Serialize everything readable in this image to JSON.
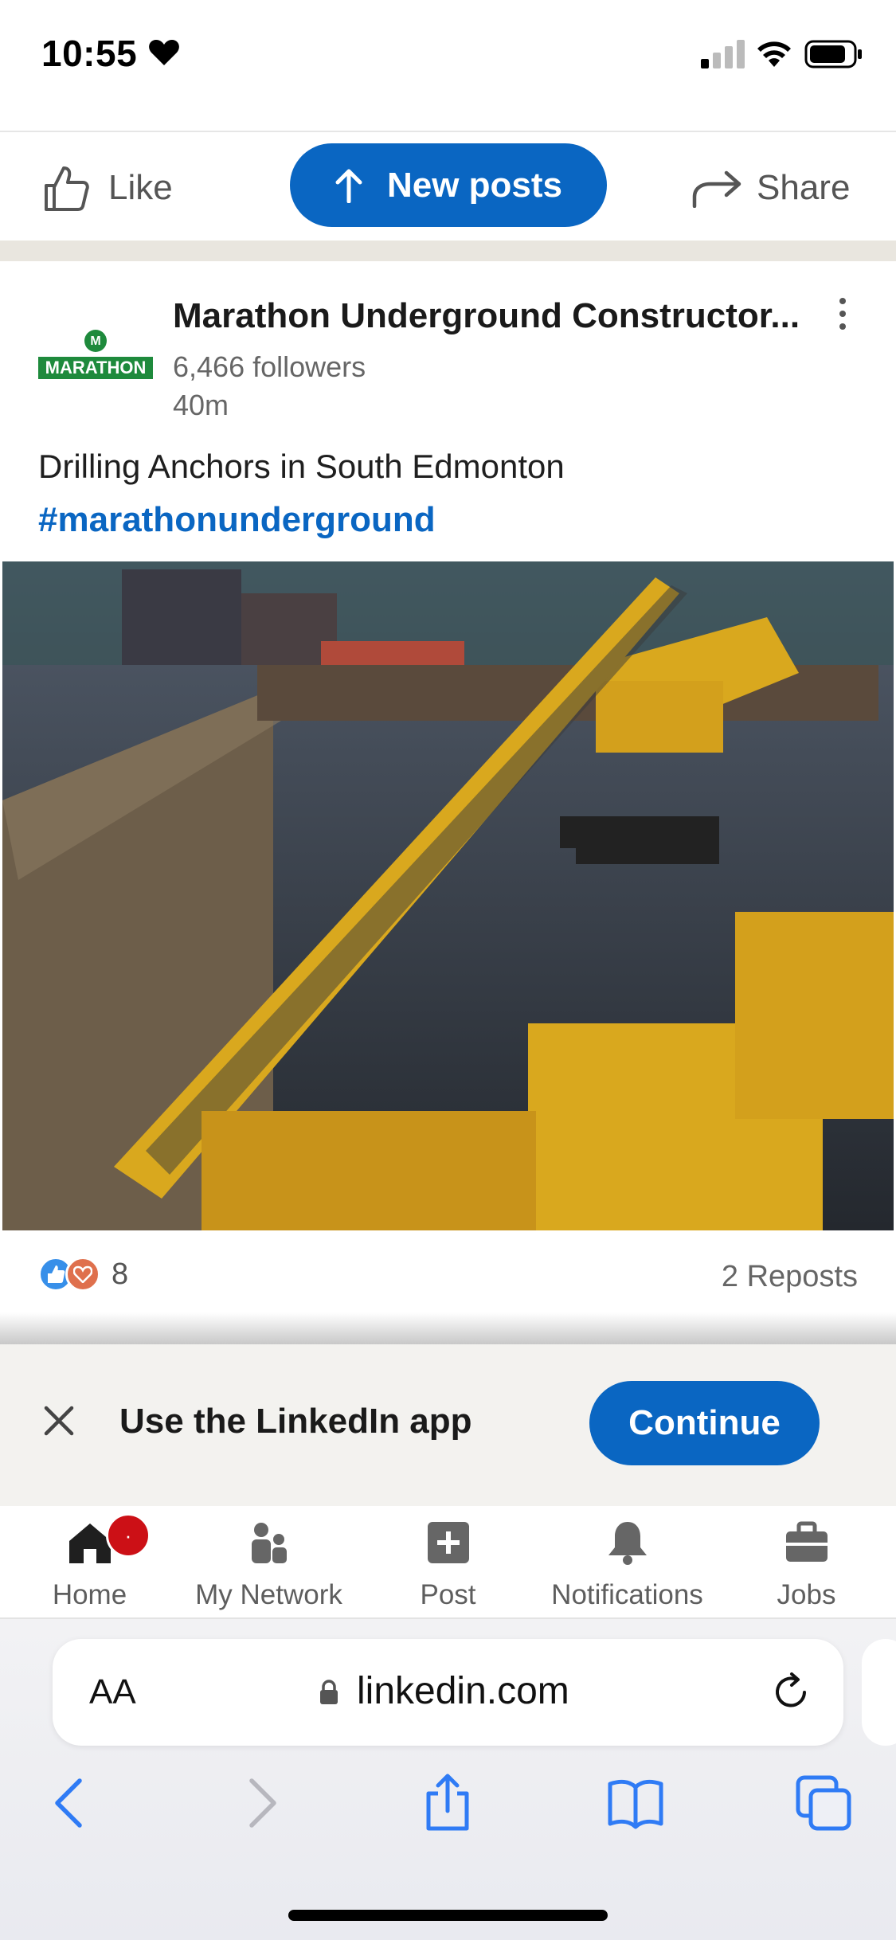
{
  "status_bar": {
    "time": "10:55"
  },
  "action_bar": {
    "like_label": "Like",
    "new_posts_label": "New posts",
    "share_label": "Share"
  },
  "post": {
    "company": "Marathon Underground Constructor...",
    "logo_text": "MARATHON",
    "followers": "6,466 followers",
    "age": "40m",
    "text": "Drilling Anchors in South Edmonton",
    "hashtag": "#marathonunderground",
    "image_alt": "Yellow drilling rig drilling anchors in an excavation at dusk",
    "reaction_count": "8",
    "reposts": "2 Reposts",
    "reaction_icons": [
      "thumbs-up-icon",
      "heart-icon"
    ]
  },
  "app_banner": {
    "text": "Use the LinkedIn app",
    "button": "Continue"
  },
  "bottom_nav": [
    {
      "label": "Home",
      "icon": "home-icon",
      "badge": "·"
    },
    {
      "label": "My Network",
      "icon": "network-icon"
    },
    {
      "label": "Post",
      "icon": "post-icon"
    },
    {
      "label": "Notifications",
      "icon": "bell-icon"
    },
    {
      "label": "Jobs",
      "icon": "briefcase-icon"
    }
  ],
  "browser": {
    "aa_label": "AA",
    "url": "linkedin.com"
  },
  "colors": {
    "brand_blue": "#0a66c2",
    "badge_red": "#cc1016",
    "banner_bg": "#f3f2ef",
    "logo_green": "#1e8a3c"
  }
}
